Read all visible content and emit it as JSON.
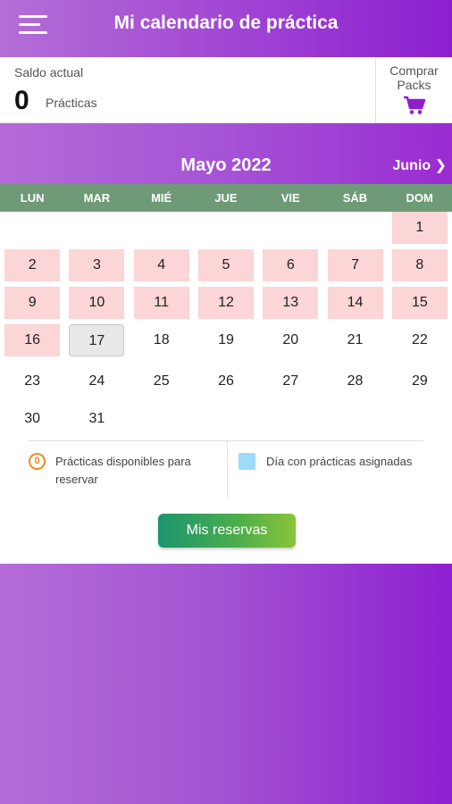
{
  "header": {
    "title": "Mi calendario de práctica"
  },
  "balance": {
    "label": "Saldo actual",
    "count": "0",
    "unit": "Prácticas",
    "buy_label_1": "Comprar",
    "buy_label_2": "Packs"
  },
  "calendar": {
    "month": "Mayo 2022",
    "next_month": "Junio",
    "weekdays": [
      "LUN",
      "MAR",
      "MIÉ",
      "JUE",
      "VIE",
      "SÁB",
      "DOM"
    ],
    "first_weekday_index": 6,
    "days_in_month": 31,
    "highlighted_days": [
      1,
      2,
      3,
      4,
      5,
      6,
      7,
      8,
      9,
      10,
      11,
      12,
      13,
      14,
      15,
      16
    ],
    "today": 17
  },
  "legend": {
    "available_icon_text": "0",
    "available_text": "Prácticas disponibles para reservar",
    "assigned_text": "Día con prácticas asignadas"
  },
  "actions": {
    "reservations_label": "Mis reservas"
  },
  "colors": {
    "highlight": "#fcd5d6",
    "weekday_bar": "#6e9a78",
    "accent": "#9e3fd4",
    "legend_swatch": "#9cdcf9",
    "legend_orange": "#f08a1e"
  }
}
